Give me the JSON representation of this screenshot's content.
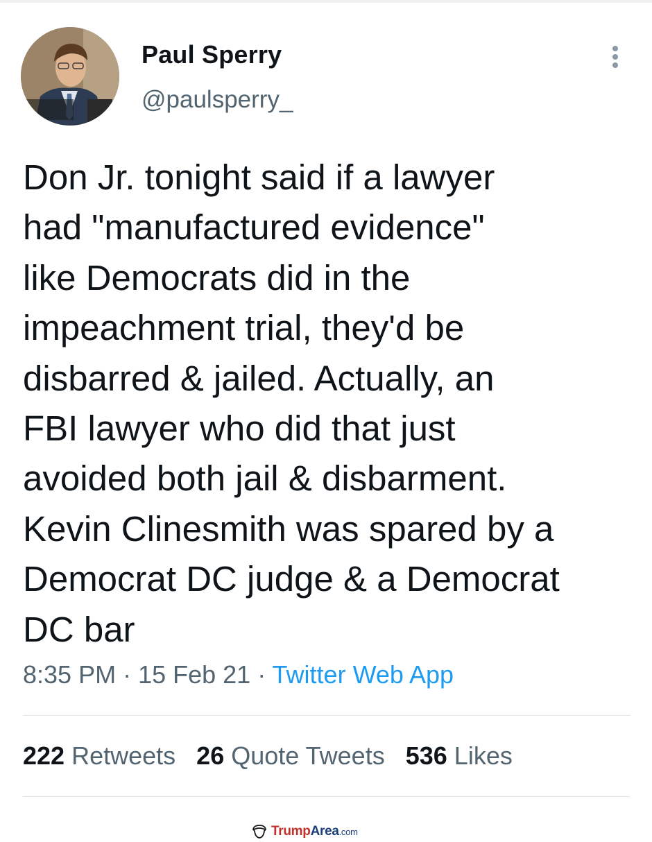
{
  "author": {
    "display_name": "Paul Sperry",
    "handle": "@paulsperry_"
  },
  "tweet": {
    "lines": [
      "Don Jr. tonight said if a lawyer",
      "had \"manufactured evidence\"",
      "like Democrats did in the",
      "impeachment trial, they'd be",
      "disbarred & jailed. Actually, an",
      "FBI lawyer who did that just",
      "avoided both jail & disbarment.",
      "Kevin Clinesmith was spared by a",
      "Democrat DC judge & a Democrat",
      "DC bar"
    ],
    "time": "8:35 PM",
    "sep1": " · ",
    "date": "15 Feb 21",
    "sep2": " · ",
    "source": "Twitter Web App"
  },
  "stats": {
    "retweets_count": "222",
    "retweets_label": "Retweets",
    "quotes_count": "26",
    "quotes_label": "Quote Tweets",
    "likes_count": "536",
    "likes_label": "Likes"
  },
  "watermark": {
    "part1": "Trump",
    "part2": "Area",
    "part3": ".com"
  },
  "icons": {
    "more": "more-vertical-icon",
    "watermark": "trumparea-logo-icon"
  },
  "colors": {
    "text": "#0f1419",
    "secondary": "#536471",
    "link": "#1d9bf0",
    "divider": "#e1e6ea"
  }
}
